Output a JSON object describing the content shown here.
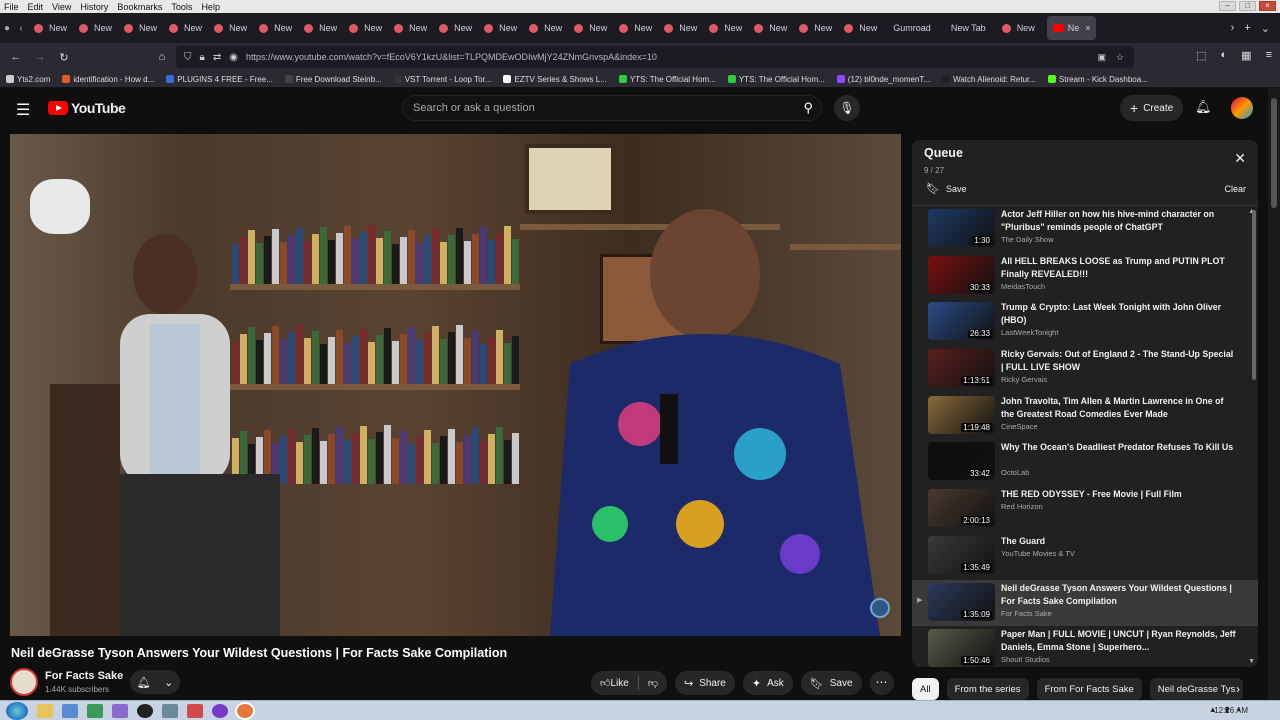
{
  "menubar": {
    "items": [
      "File",
      "Edit",
      "View",
      "History",
      "Bookmarks",
      "Tools",
      "Help"
    ]
  },
  "tabs": {
    "items": [
      "New",
      "New",
      "New",
      "New",
      "New",
      "New",
      "New",
      "New",
      "New",
      "New",
      "New",
      "New",
      "New",
      "New",
      "New",
      "New",
      "New",
      "New",
      "New"
    ],
    "named": [
      "Gumroad",
      "New Tab",
      "New"
    ],
    "active": "Ne"
  },
  "navbar": {
    "url": "https://www.youtube.com/watch?v=fEcoV6Y1kzU&list=TLPQMDEwODIwMjY24ZNmGnvspA&index=10"
  },
  "bookmarks": [
    {
      "label": "Yts2.com",
      "color": "#cccccc"
    },
    {
      "label": "identification - How d...",
      "color": "#e05a2a"
    },
    {
      "label": "PLUGINS 4 FREE - Free...",
      "color": "#3a6fd8"
    },
    {
      "label": "Free Download Steinb...",
      "color": "#444444"
    },
    {
      "label": "VST Torrent - Loop Tor...",
      "color": "#333333"
    },
    {
      "label": "EZTV Series & Shows L...",
      "color": "#ffffff"
    },
    {
      "label": "YTS: The Official Hom...",
      "color": "#2ecc40"
    },
    {
      "label": "YTS: The Official Hom...",
      "color": "#2ecc40"
    },
    {
      "label": "(12) bl0nde_momenT...",
      "color": "#9146ff"
    },
    {
      "label": "Watch Alienoid: Retur...",
      "color": "#222222"
    },
    {
      "label": "Stream - Kick Dashboa...",
      "color": "#53fc18"
    }
  ],
  "youtube": {
    "logo_text": "YouTube",
    "search_placeholder": "Search or ask a question",
    "create_label": "Create"
  },
  "video": {
    "title": "Neil deGrasse Tyson Answers Your Wildest Questions | For Facts Sake Compilation",
    "channel": "For Facts Sake",
    "subscribers": "1.44K subscribers",
    "like_label": "Like",
    "share_label": "Share",
    "ask_label": "Ask",
    "save_label": "Save"
  },
  "queue": {
    "title": "Queue",
    "count": "9 / 27",
    "save_label": "Save",
    "clear_label": "Clear",
    "items": [
      {
        "title": "Actor Jeff Hiller on how his hive-mind character on \"Pluribus\" reminds people of ChatGPT",
        "channel": "The Daily Show",
        "duration": "1:30",
        "color": "#1d3a66"
      },
      {
        "title": "All HELL BREAKS LOOSE as Trump and PUTIN PLOT Finally REVEALED!!!",
        "channel": "MeidasTouch",
        "duration": "30:33",
        "color": "#7a1010"
      },
      {
        "title": "Trump & Crypto: Last Week Tonight with John Oliver (HBO)",
        "channel": "LastWeekTonight",
        "duration": "26:33",
        "color": "#2a4c88"
      },
      {
        "title": "Ricky Gervais: Out of England 2 - The Stand-Up Special | FULL LIVE SHOW",
        "channel": "Ricky Gervais",
        "duration": "1:13:51",
        "color": "#5a1d1d"
      },
      {
        "title": "John Travolta, Tim Allen & Martin Lawrence in One of the Greatest Road Comedies Ever Made",
        "channel": "CineSpace",
        "duration": "1:19:48",
        "color": "#8a6a3a"
      },
      {
        "title": "Why The Ocean's Deadliest Predator Refuses To Kill Us",
        "channel": "OctoLab",
        "duration": "33:42",
        "color": "#0d0d0d"
      },
      {
        "title": "THE RED ODYSSEY - Free Movie | Full Film",
        "channel": "Red Horizon",
        "duration": "2:00:13",
        "color": "#4a3a30"
      },
      {
        "title": "The Guard",
        "channel": "YouTube Movies & TV",
        "duration": "1:35:49",
        "color": "#3a3a3a"
      },
      {
        "title": "Neil deGrasse Tyson Answers Your Wildest Questions | For Facts Sake Compilation",
        "channel": "For Facts Sake",
        "duration": "1:35:09",
        "color": "#2a3a5a"
      },
      {
        "title": "Paper Man | FULL MOVIE | UNCUT | Ryan Reynolds, Jeff Daniels, Emma Stone | Superhero...",
        "channel": "Shout! Studios",
        "duration": "1:50:46",
        "color": "#5a5a4a"
      }
    ]
  },
  "chips": [
    "All",
    "From the series",
    "From For Facts Sake",
    "Neil deGrasse Tys"
  ],
  "taskbar": {
    "clock": "12:26 AM"
  }
}
